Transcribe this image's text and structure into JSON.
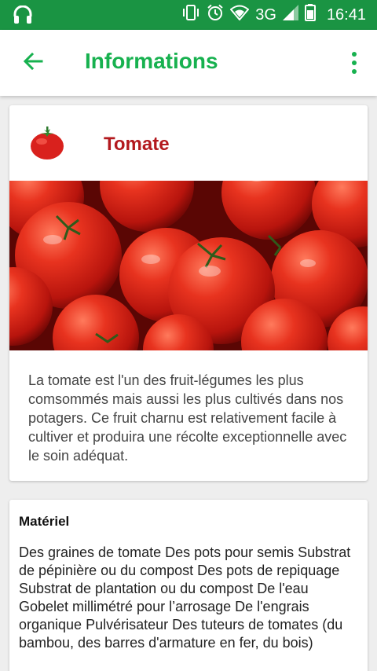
{
  "status_bar": {
    "network": "3G",
    "time": "16:41",
    "battery_level": "68",
    "icons": [
      "headphones-icon",
      "vibrate-icon",
      "alarm-icon",
      "wifi-icon",
      "signal-icon",
      "battery-icon"
    ],
    "background_color": "#1a9443"
  },
  "app_bar": {
    "title": "Informations",
    "accent_color": "#17b14f",
    "back_icon": "arrow-left-icon",
    "menu_icon": "more-vertical-icon"
  },
  "vegetable": {
    "name": "Tomate",
    "name_color": "#b3191e",
    "icon": "tomato-icon",
    "image": "tomatoes-photo",
    "description": "La tomate est l'un des fruit-légumes les plus comsommés mais aussi les plus cultivés dans nos potagers. Ce fruit charnu est relativement facile à cultiver et produira une récolte exceptionnelle avec le soin adéquat."
  },
  "material": {
    "title": "Matériel",
    "text": "Des graines de tomate Des pots pour semis Substrat de pépinière ou du compost Des pots de repiquage Substrat de plantation ou du compost De l'eau Gobelet millimétré pour l’arrosage De l'engrais organique Pulvérisateur Des tuteurs de tomates (du bambou, des barres d'armature en fer, du bois)"
  }
}
